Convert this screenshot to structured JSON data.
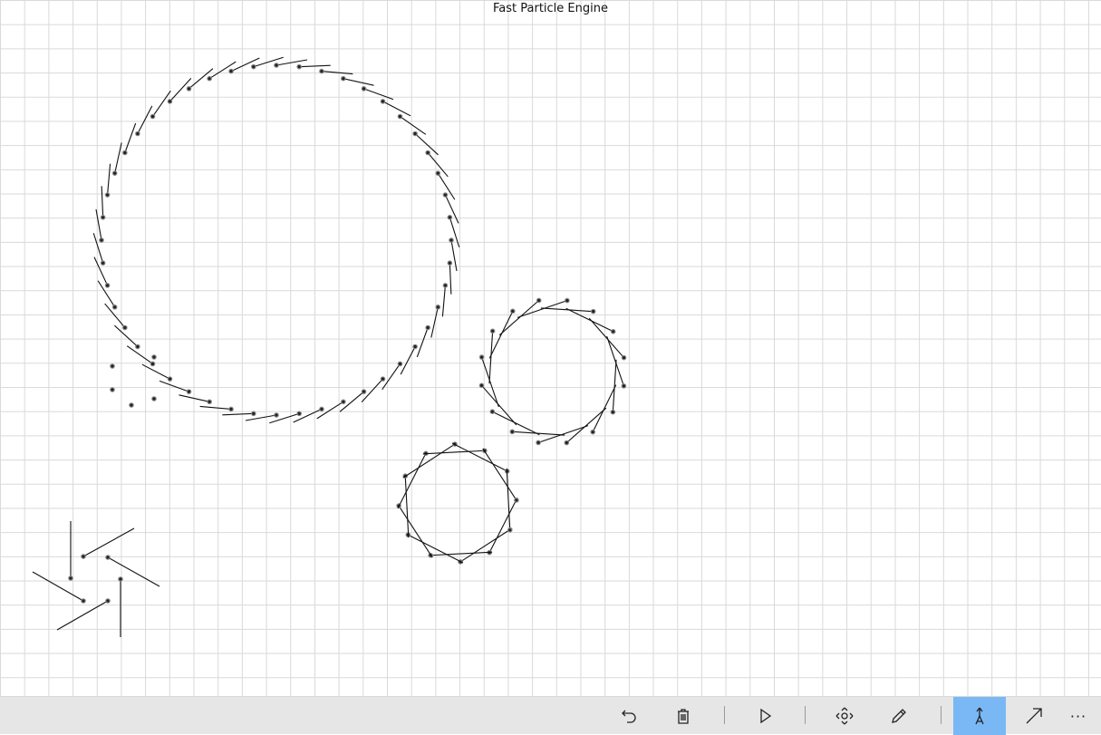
{
  "app": {
    "title": "Fast Particle Engine"
  },
  "toolbar": {
    "buttons": [
      {
        "name": "undo-button",
        "icon": "undo-icon"
      },
      {
        "name": "delete-button",
        "icon": "trash-icon"
      },
      {
        "name": "play-button",
        "icon": "play-icon"
      },
      {
        "name": "move-button",
        "icon": "move-icon"
      },
      {
        "name": "draw-button",
        "icon": "pencil-icon"
      },
      {
        "name": "particle-tool-button",
        "icon": "particle-tool-icon",
        "active": true
      },
      {
        "name": "vector-button",
        "icon": "arrow-icon"
      },
      {
        "name": "more-button",
        "icon": "more-icon",
        "label": "···"
      }
    ],
    "active_color": "#7ab8f5"
  }
}
